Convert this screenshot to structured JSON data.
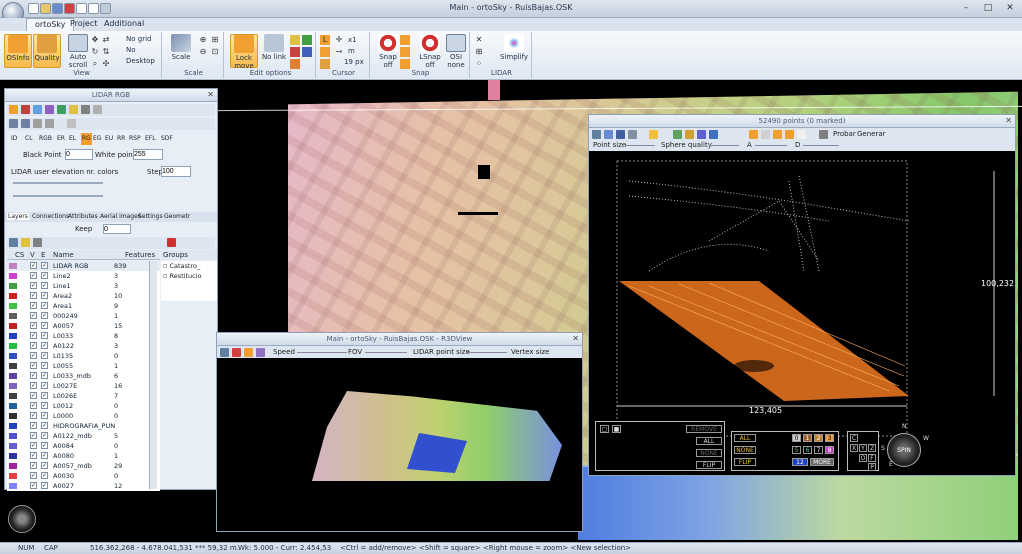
{
  "window": {
    "title": "Main - ortoSky - RuisBajas.OSK"
  },
  "tabs": [
    {
      "label": "ortoSky"
    },
    {
      "label": "Project"
    },
    {
      "label": "Additional"
    }
  ],
  "ribbon": {
    "view": {
      "label": "View",
      "osinfo": "OSInfo",
      "quality": "Quality",
      "autoscroll": "Auto scroll",
      "nogrid": "No grid",
      "no": "No",
      "desktop": "Desktop"
    },
    "scale": {
      "label": "Scale",
      "scale_btn": "Scale"
    },
    "edit": {
      "label": "Edit options",
      "lock_move": "Lock move",
      "no_link": "No link"
    },
    "cursor": {
      "label": "Cursor",
      "x1": "x1",
      "m": "m",
      "px": "19 px"
    },
    "snap": {
      "label": "Snap",
      "snap_off": "Snap off",
      "lsnap_off": "LSnap off",
      "osi_none": "OSI none"
    },
    "lidar": {
      "label": "LIDAR",
      "simplify": "Simplify"
    }
  },
  "lidar_panel": {
    "title": "LIDAR RGB",
    "modes": [
      "ID",
      "CL",
      "RGB",
      "ER",
      "EL",
      "RG",
      "EG",
      "EU",
      "RR",
      "RSP",
      "EFL",
      "SDF"
    ],
    "black_point_label": "Black Point",
    "black_point_value": "0",
    "white_point_label": "White point",
    "white_point_value": "255",
    "elevation_label": "LIDAR user elevation nr. colors",
    "step_label": "Step",
    "step_value": "100"
  },
  "layer_tabs": [
    "Layers",
    "Connections",
    "Attributes",
    "Aerial images",
    "Settings",
    "Geometr"
  ],
  "keep": {
    "label": "Keep",
    "value": "0"
  },
  "layer_table": {
    "headers": {
      "cs": "CS",
      "v": "V",
      "e": "E",
      "name": "Name",
      "features": "Features"
    },
    "rows": [
      {
        "name": "LIDAR RGB",
        "features": "839",
        "color": "#c080c0"
      },
      {
        "name": "Line2",
        "features": "3",
        "color": "#d040d0"
      },
      {
        "name": "Line1",
        "features": "3",
        "color": "#40a040"
      },
      {
        "name": "Area2",
        "features": "10",
        "color": "#d02020"
      },
      {
        "name": "Area1",
        "features": "9",
        "color": "#40c040"
      },
      {
        "name": "000249",
        "features": "1",
        "color": "#606060"
      },
      {
        "name": "A0057",
        "features": "15",
        "color": "#c02020"
      },
      {
        "name": "L0033",
        "features": "8",
        "color": "#2040c0"
      },
      {
        "name": "A0122",
        "features": "3",
        "color": "#20c040"
      },
      {
        "name": "L0135",
        "features": "0",
        "color": "#3050c0"
      },
      {
        "name": "L0055",
        "features": "1",
        "color": "#404040"
      },
      {
        "name": "L0033_mdb",
        "features": "6",
        "color": "#6040a0"
      },
      {
        "name": "L0027E",
        "features": "16",
        "color": "#8060c0"
      },
      {
        "name": "L0026E",
        "features": "7",
        "color": "#404040"
      },
      {
        "name": "L0012",
        "features": "0",
        "color": "#2060a0"
      },
      {
        "name": "L0000",
        "features": "0",
        "color": "#303030"
      },
      {
        "name": "HIDROGRAFIA_PUN",
        "features": "",
        "color": "#2040c0"
      },
      {
        "name": "A0122_mdb",
        "features": "5",
        "color": "#5050d0"
      },
      {
        "name": "A0084",
        "features": "0",
        "color": "#6060d0"
      },
      {
        "name": "A0080",
        "features": "1",
        "color": "#3030a0"
      },
      {
        "name": "A0057_mdb",
        "features": "29",
        "color": "#a020a0"
      },
      {
        "name": "A0030",
        "features": "0",
        "color": "#e04040"
      },
      {
        "name": "A0027",
        "features": "12",
        "color": "#8080ff"
      }
    ]
  },
  "groups": {
    "header": "Groups",
    "items": [
      "Catastro_",
      "Restitucio"
    ]
  },
  "r3d": {
    "title": "Main - ortoSky - RuisBajas.OSK - R3DView",
    "speed": "Speed",
    "fov": "FOV",
    "lidar_point_size": "LIDAR point size",
    "vertex_size": "Vertex size"
  },
  "pc": {
    "title": "52490 points (0 marked)",
    "probar": "Probar",
    "generar": "Generar",
    "point_size": "Point size",
    "sphere_quality": "Sphere quality",
    "a": "A",
    "d": "D",
    "width_dim": "123,405",
    "height_dim": "100,232",
    "spin": "SPIN",
    "compass": [
      "N",
      "S",
      "W",
      "E"
    ],
    "pad_all": "ALL",
    "pad_none": "NONE",
    "pad_flip": "FLIP",
    "pad_remove": "REMOVE",
    "classes": [
      "0",
      "1",
      "2",
      "3",
      "4",
      "5",
      "6",
      "7",
      "8",
      "9",
      "12"
    ],
    "more": "MORE",
    "axes": [
      "C",
      "X",
      "Y",
      "Z",
      "O",
      "F",
      "P"
    ]
  },
  "status": {
    "num": "NUM",
    "cap": "CAP",
    "coords": "516.362,268 - 4.678.041,531 *** 59,32 m.",
    "wk": "Wk: 5.000 - Curr: 2.454,53",
    "hint": "<Ctrl = add/remove> <Shift = square> <Right mouse = zoom> <New selection>"
  },
  "colors": {
    "accent": "#f0a030",
    "ribbon_bg": "#dfe7f1",
    "orange_cloud": "#f08020"
  }
}
